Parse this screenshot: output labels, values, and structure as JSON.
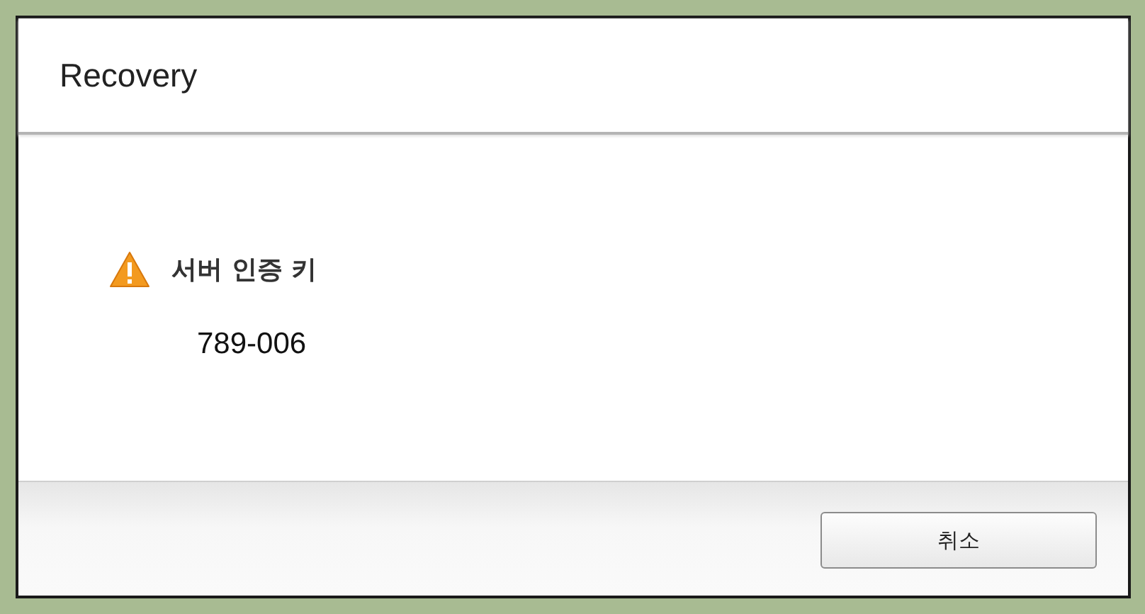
{
  "window": {
    "title": "Recovery"
  },
  "message": {
    "heading": "서버 인증 키",
    "code": "789-006"
  },
  "buttons": [
    {
      "label": "취소"
    }
  ]
}
